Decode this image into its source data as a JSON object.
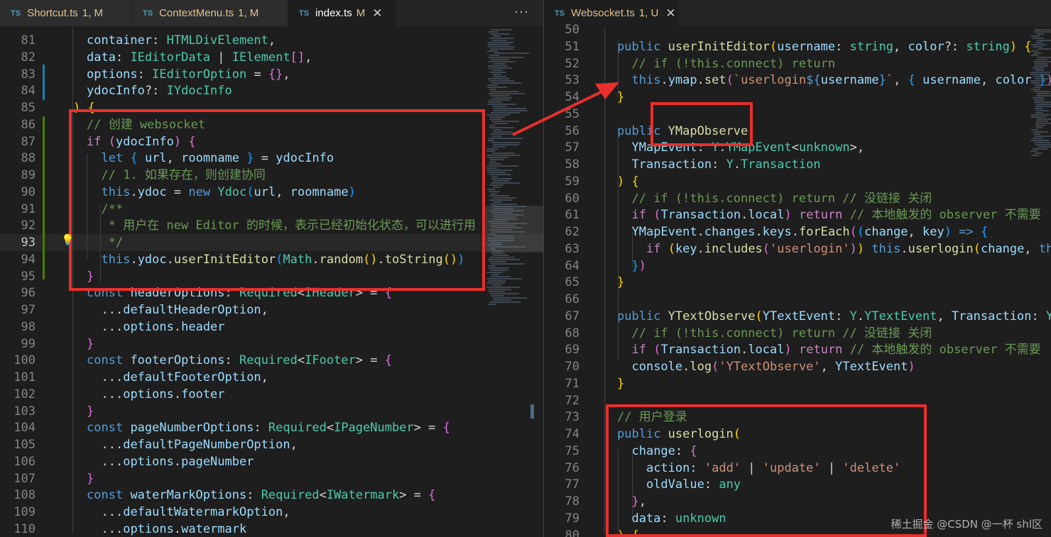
{
  "left_editor": {
    "tabs": [
      {
        "label": "Shortcut.ts",
        "status": "1, M",
        "lang": "TS",
        "active": false
      },
      {
        "label": "ContextMenu.ts",
        "status": "1, M",
        "lang": "TS",
        "active": false
      },
      {
        "label": "index.ts",
        "status": "M",
        "lang": "TS",
        "active": true,
        "close": "✕"
      }
    ],
    "more_actions": "···",
    "lines": [
      {
        "n": "81",
        "html": "<span class='v'>container</span><span class='p'>: </span><span class='t'>HTMLDivElement</span><span class='p'>,</span>"
      },
      {
        "n": "82",
        "html": "<span class='v'>data</span><span class='p'>: </span><span class='t'>IEditorData</span><span class='p'> | </span><span class='t'>IElement</span><span class='b2'>[]</span><span class='p'>,</span>"
      },
      {
        "n": "83",
        "html": "<span class='v'>options</span><span class='p'>: </span><span class='t'>IEditorOption</span><span class='p'> = </span><span class='b2'>{}</span><span class='p'>,</span>"
      },
      {
        "n": "84",
        "html": "<span class='v'>ydocInfo</span><span class='p'>?: </span><span class='t'>IYdocInfo</span>"
      },
      {
        "n": "85",
        "html": "<span class='b1'>)</span><span class='p'> </span><span class='b1'>{</span>",
        "indent": -1
      },
      {
        "n": "86",
        "html": "<span class='m'>// 创建 websocket</span>"
      },
      {
        "n": "87",
        "html": "<span class='c'>if</span><span class='p'> </span><span class='b2'>(</span><span class='v'>ydocInfo</span><span class='b2'>)</span><span class='p'> </span><span class='b2'>{</span>"
      },
      {
        "n": "88",
        "html": "  <span class='k'>let</span><span class='p'> </span><span class='b3'>{</span><span class='p'> </span><span class='v'>url</span><span class='p'>, </span><span class='v'>roomname</span><span class='p'> </span><span class='b3'>}</span><span class='p'> = </span><span class='v'>ydocInfo</span>"
      },
      {
        "n": "89",
        "html": "  <span class='m'>// 1. 如果存在，则创建协同</span>"
      },
      {
        "n": "90",
        "html": "  <span class='k'>this</span><span class='p'>.</span><span class='v'>ydoc</span><span class='p'> = </span><span class='k'>new</span><span class='p'> </span><span class='t'>Ydoc</span><span class='b3'>(</span><span class='v'>url</span><span class='p'>, </span><span class='v'>roomname</span><span class='b3'>)</span>"
      },
      {
        "n": "91",
        "html": "  <span class='m'>/**</span>"
      },
      {
        "n": "92",
        "html": "  <span class='m'> * 用户在 new Editor 的时候，表示已经初始化状态，可以进行用</span>"
      },
      {
        "n": "93",
        "html": "  <span class='m'> */</span>",
        "current": true
      },
      {
        "n": "94",
        "html": "  <span class='k'>this</span><span class='p'>.</span><span class='v'>ydoc</span><span class='p'>.</span><span class='f'>userInitEditor</span><span class='b3'>(</span><span class='t'>Math</span><span class='p'>.</span><span class='f'>random</span><span class='b1'>()</span><span class='p'>.</span><span class='f'>toString</span><span class='b1'>()</span><span class='b3'>)</span>"
      },
      {
        "n": "95",
        "html": "<span class='b2'>}</span>"
      },
      {
        "n": "96",
        "html": "<span class='k'>const</span><span class='p'> </span><span class='v'>headerOptions</span><span class='p'>: </span><span class='t'>Required</span><span class='p'>&lt;</span><span class='t'>IHeader</span><span class='p'>&gt; = </span><span class='b2'>{</span>"
      },
      {
        "n": "97",
        "html": "  <span class='p'>...</span><span class='v'>defaultHeaderOption</span><span class='p'>,</span>"
      },
      {
        "n": "98",
        "html": "  <span class='p'>...</span><span class='v'>options</span><span class='p'>.</span><span class='v'>header</span>"
      },
      {
        "n": "99",
        "html": "<span class='b2'>}</span>"
      },
      {
        "n": "100",
        "html": "<span class='k'>const</span><span class='p'> </span><span class='v'>footerOptions</span><span class='p'>: </span><span class='t'>Required</span><span class='p'>&lt;</span><span class='t'>IFooter</span><span class='p'>&gt; = </span><span class='b2'>{</span>"
      },
      {
        "n": "101",
        "html": "  <span class='p'>...</span><span class='v'>defaultFooterOption</span><span class='p'>,</span>"
      },
      {
        "n": "102",
        "html": "  <span class='p'>...</span><span class='v'>options</span><span class='p'>.</span><span class='v'>footer</span>"
      },
      {
        "n": "103",
        "html": "<span class='b2'>}</span>"
      },
      {
        "n": "104",
        "html": "<span class='k'>const</span><span class='p'> </span><span class='v'>pageNumberOptions</span><span class='p'>: </span><span class='t'>Required</span><span class='p'>&lt;</span><span class='t'>IPageNumber</span><span class='p'>&gt; = </span><span class='b2'>{</span>"
      },
      {
        "n": "105",
        "html": "  <span class='p'>...</span><span class='v'>defaultPageNumberOption</span><span class='p'>,</span>"
      },
      {
        "n": "106",
        "html": "  <span class='p'>...</span><span class='v'>options</span><span class='p'>.</span><span class='v'>pageNumber</span>"
      },
      {
        "n": "107",
        "html": "<span class='b2'>}</span>"
      },
      {
        "n": "108",
        "html": "<span class='k'>const</span><span class='p'> </span><span class='v'>waterMarkOptions</span><span class='p'>: </span><span class='t'>Required</span><span class='p'>&lt;</span><span class='t'>IWatermark</span><span class='p'>&gt; = </span><span class='b2'>{</span>"
      },
      {
        "n": "109",
        "html": "  <span class='p'>...</span><span class='v'>defaultWatermarkOption</span><span class='p'>,</span>"
      },
      {
        "n": "110",
        "html": "  <span class='p'>...</span><span class='v'>options</span><span class='p'>.</span><span class='v'>watermark</span>"
      }
    ]
  },
  "right_editor": {
    "tabs": [
      {
        "label": "Websocket.ts",
        "status": "1, U",
        "lang": "TS",
        "active": true,
        "close": "✕"
      }
    ],
    "lines": [
      {
        "n": "50",
        "html": ""
      },
      {
        "n": "51",
        "html": "<span class='k'>public</span><span class='p'> </span><span class='f'>userInitEditor</span><span class='b1'>(</span><span class='v'>username</span><span class='p'>: </span><span class='t'>string</span><span class='p'>, </span><span class='v'>color</span><span class='p'>?: </span><span class='t'>string</span><span class='b1'>)</span><span class='p'> </span><span class='b1'>{</span>"
      },
      {
        "n": "52",
        "html": "  <span class='m'>// if (!this.connect) return</span>"
      },
      {
        "n": "53",
        "html": "  <span class='k'>this</span><span class='p'>.</span><span class='v'>ymap</span><span class='p'>.</span><span class='f'>set</span><span class='b2'>(</span><span class='s'>`userlogin</span><span class='k'>${</span><span class='v'>username</span><span class='k'>}</span><span class='s'>`</span><span class='p'>, </span><span class='b3'>{</span><span class='p'> </span><span class='v'>username</span><span class='p'>, </span><span class='v'>color</span><span class='p'> </span><span class='b3'>}</span><span class='b2'>)</span>"
      },
      {
        "n": "54",
        "html": "<span class='b1'>}</span>"
      },
      {
        "n": "55",
        "html": ""
      },
      {
        "n": "56",
        "html": "<span class='k'>public</span><span class='p'> </span><span class='f'>YMapObserve</span><span class='b1'>(</span>"
      },
      {
        "n": "57",
        "html": "  <span class='v'>YMapEvent</span><span class='p'>: </span><span class='t'>Y</span><span class='p'>.</span><span class='t'>YMapEvent</span><span class='p'>&lt;</span><span class='t'>unknown</span><span class='p'>&gt;,</span>"
      },
      {
        "n": "58",
        "html": "  <span class='v'>Transaction</span><span class='p'>: </span><span class='t'>Y</span><span class='p'>.</span><span class='t'>Transaction</span>"
      },
      {
        "n": "59",
        "html": "<span class='b1'>)</span><span class='p'> </span><span class='b1'>{</span>"
      },
      {
        "n": "60",
        "html": "  <span class='m'>// if (!this.connect) return // 没链接 关闭</span>"
      },
      {
        "n": "61",
        "html": "  <span class='c'>if</span><span class='p'> </span><span class='b2'>(</span><span class='v'>Transaction</span><span class='p'>.</span><span class='v'>local</span><span class='b2'>)</span><span class='p'> </span><span class='c'>return</span><span class='p'> </span><span class='m'>// 本地触发的 observer 不需要</span>"
      },
      {
        "n": "62",
        "html": "  <span class='v'>YMapEvent</span><span class='p'>.</span><span class='v'>changes</span><span class='p'>.</span><span class='v'>keys</span><span class='p'>.</span><span class='f'>forEach</span><span class='b2'>(</span><span class='b3'>(</span><span class='v'>change</span><span class='p'>, </span><span class='v'>key</span><span class='b3'>)</span><span class='p'> </span><span class='k'>=&gt;</span><span class='p'> </span><span class='b3'>{</span>"
      },
      {
        "n": "63",
        "html": "    <span class='c'>if</span><span class='p'> </span><span class='b1'>(</span><span class='v'>key</span><span class='p'>.</span><span class='f'>includes</span><span class='b2'>(</span><span class='s'>'userlogin'</span><span class='b2'>)</span><span class='b1'>)</span><span class='p'> </span><span class='k'>this</span><span class='p'>.</span><span class='f'>userlogin</span><span class='b1'>(</span><span class='v'>change</span><span class='p'>, </span><span class='k'>th</span>"
      },
      {
        "n": "64",
        "html": "  <span class='b3'>}</span><span class='b2'>)</span>"
      },
      {
        "n": "65",
        "html": "<span class='b1'>}</span>"
      },
      {
        "n": "66",
        "html": ""
      },
      {
        "n": "67",
        "html": "<span class='k'>public</span><span class='p'> </span><span class='f'>YTextObserve</span><span class='b1'>(</span><span class='v'>YTextEvent</span><span class='p'>: </span><span class='t'>Y</span><span class='p'>.</span><span class='t'>YTextEvent</span><span class='p'>, </span><span class='v'>Transaction</span><span class='p'>: </span><span class='t'>Y</span>"
      },
      {
        "n": "68",
        "html": "  <span class='m'>// if (!this.connect) return // 没链接 关闭</span>"
      },
      {
        "n": "69",
        "html": "  <span class='c'>if</span><span class='p'> </span><span class='b2'>(</span><span class='v'>Transaction</span><span class='p'>.</span><span class='v'>local</span><span class='b2'>)</span><span class='p'> </span><span class='c'>return</span><span class='p'> </span><span class='m'>// 本地触发的 observer 不需要</span>"
      },
      {
        "n": "70",
        "html": "  <span class='v'>console</span><span class='p'>.</span><span class='f'>log</span><span class='b2'>(</span><span class='s'>'YTextObserve'</span><span class='p'>, </span><span class='v'>YTextEvent</span><span class='b2'>)</span>"
      },
      {
        "n": "71",
        "html": "<span class='b1'>}</span>"
      },
      {
        "n": "72",
        "html": ""
      },
      {
        "n": "73",
        "html": "<span class='m'>// 用户登录</span>"
      },
      {
        "n": "74",
        "html": "<span class='k'>public</span><span class='p'> </span><span class='f'>userlogin</span><span class='b1'>(</span>"
      },
      {
        "n": "75",
        "html": "  <span class='v'>change</span><span class='p'>: </span><span class='b2'>{</span>"
      },
      {
        "n": "76",
        "html": "    <span class='v'>action</span><span class='p'>: </span><span class='s'>'add'</span><span class='p'> | </span><span class='s'>'update'</span><span class='p'> | </span><span class='s'>'delete'</span>"
      },
      {
        "n": "77",
        "html": "    <span class='v'>oldValue</span><span class='p'>: </span><span class='t'>any</span>"
      },
      {
        "n": "78",
        "html": "  <span class='b2'>}</span><span class='p'>,</span>"
      },
      {
        "n": "79",
        "html": "  <span class='v'>data</span><span class='p'>: </span><span class='t'>unknown</span>"
      },
      {
        "n": "80",
        "html": "<span class='b1'>)</span><span class='p'> </span><span class='b1'>{</span>"
      }
    ]
  },
  "watermark": "稀土掘金 @CSDN @一杯 shl区",
  "colors": {
    "annotation_box": "#e8302d",
    "background": "#1e1e1e"
  }
}
